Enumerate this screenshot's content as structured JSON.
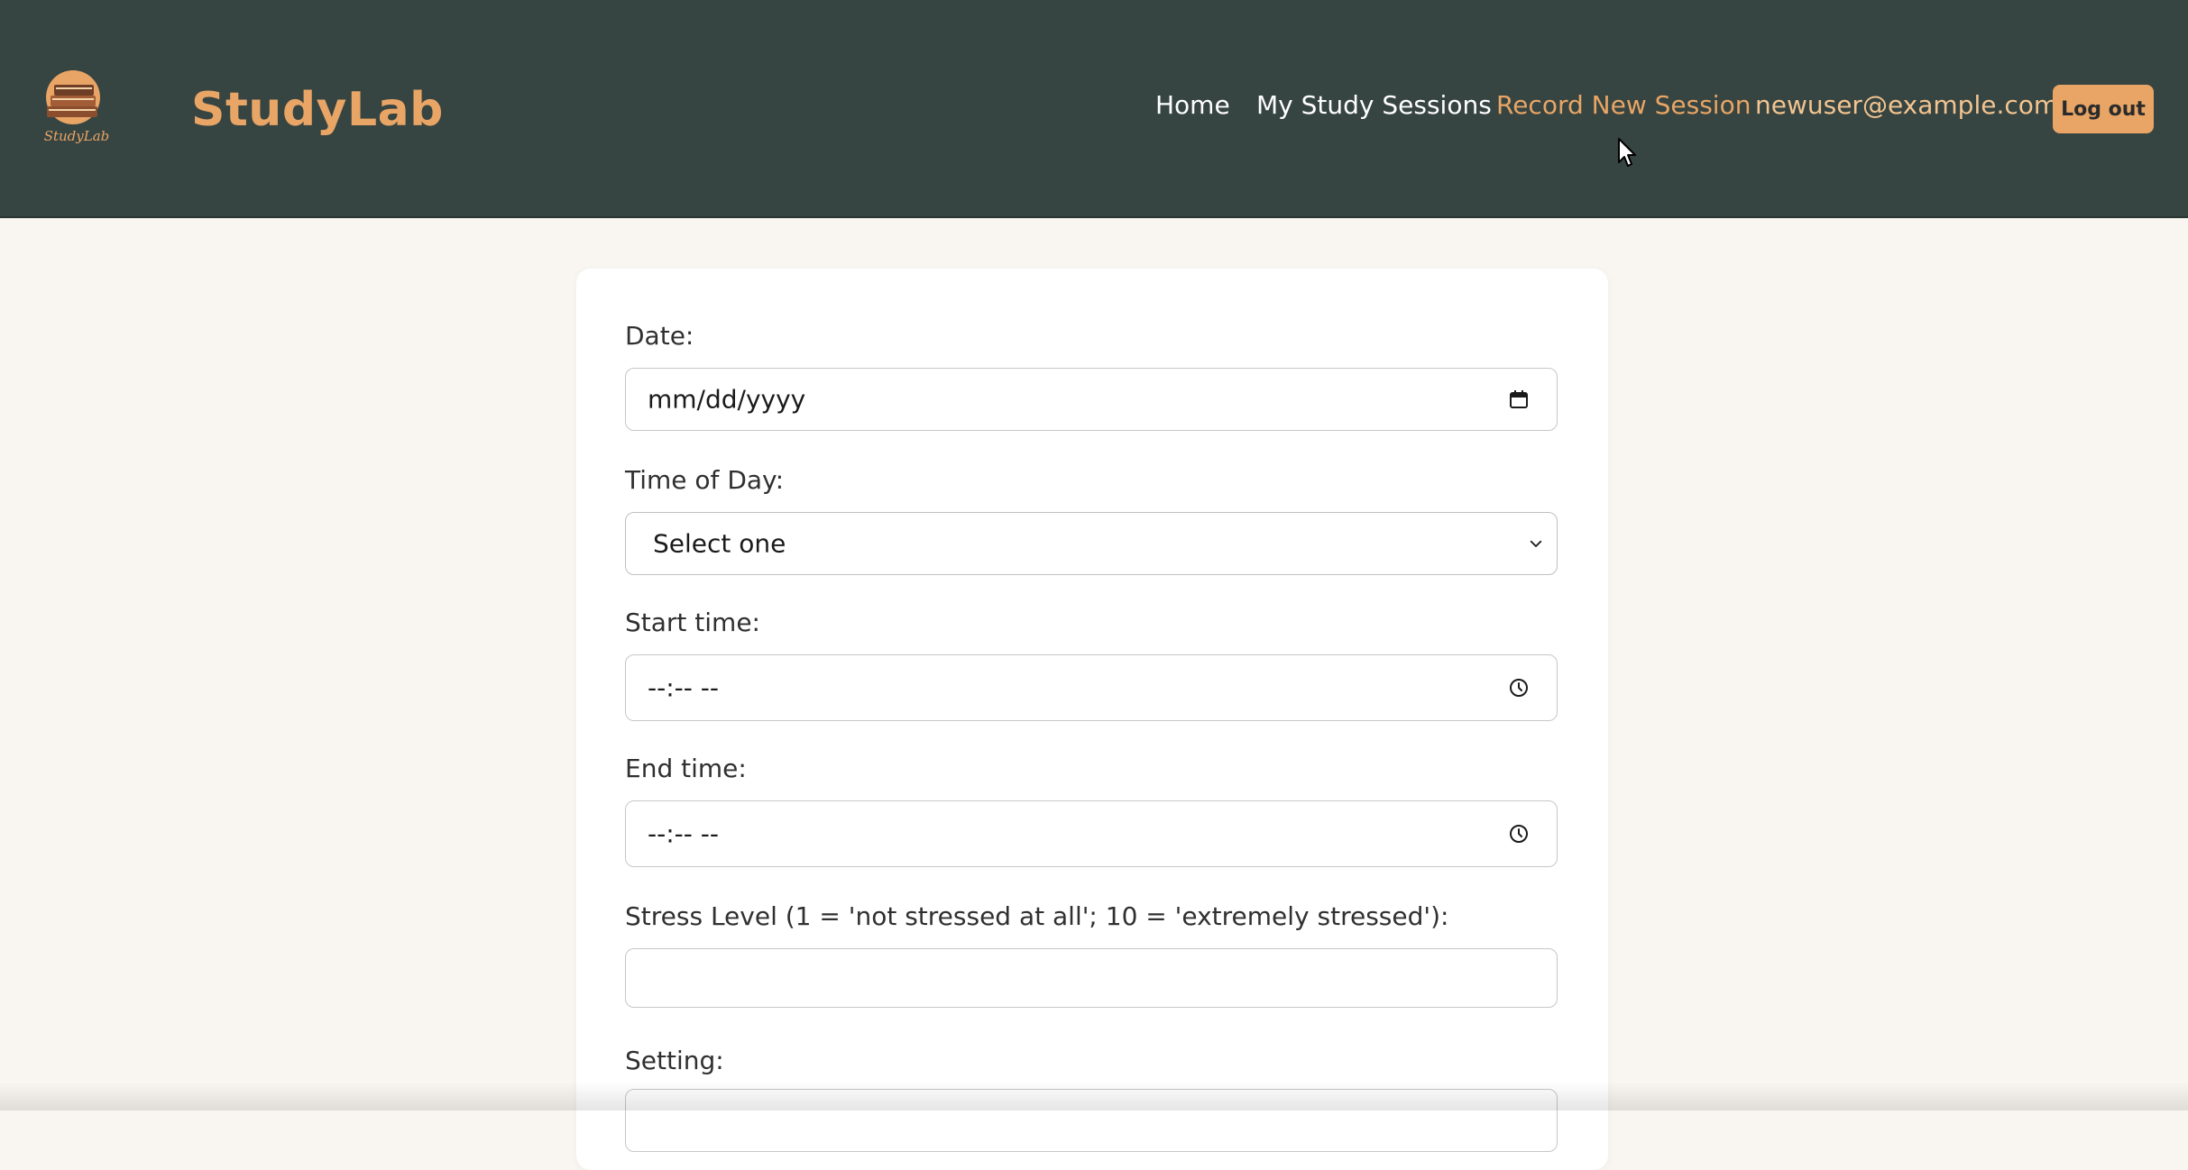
{
  "brand": {
    "logo_text": "StudyLab",
    "name": "StudyLab"
  },
  "nav": {
    "home": "Home",
    "sessions": "My Study Sessions",
    "record": "Record New Session",
    "email": "newuser@example.com",
    "logout": "Log out"
  },
  "form": {
    "date_label": "Date:",
    "date_placeholder": "mm/dd/yyyy",
    "time_of_day_label": "Time of Day:",
    "time_of_day_value": "Select one",
    "start_time_label": "Start time:",
    "start_time_placeholder": "--:-- --",
    "end_time_label": "End time:",
    "end_time_placeholder": "--:-- --",
    "stress_label": "Stress Level (1 = 'not stressed at all'; 10 = 'extremely stressed'):",
    "stress_value": "",
    "setting_label": "Setting:"
  },
  "colors": {
    "navbar_bg": "#364442",
    "accent": "#e8a565",
    "page_bg": "#f9f6f1"
  }
}
